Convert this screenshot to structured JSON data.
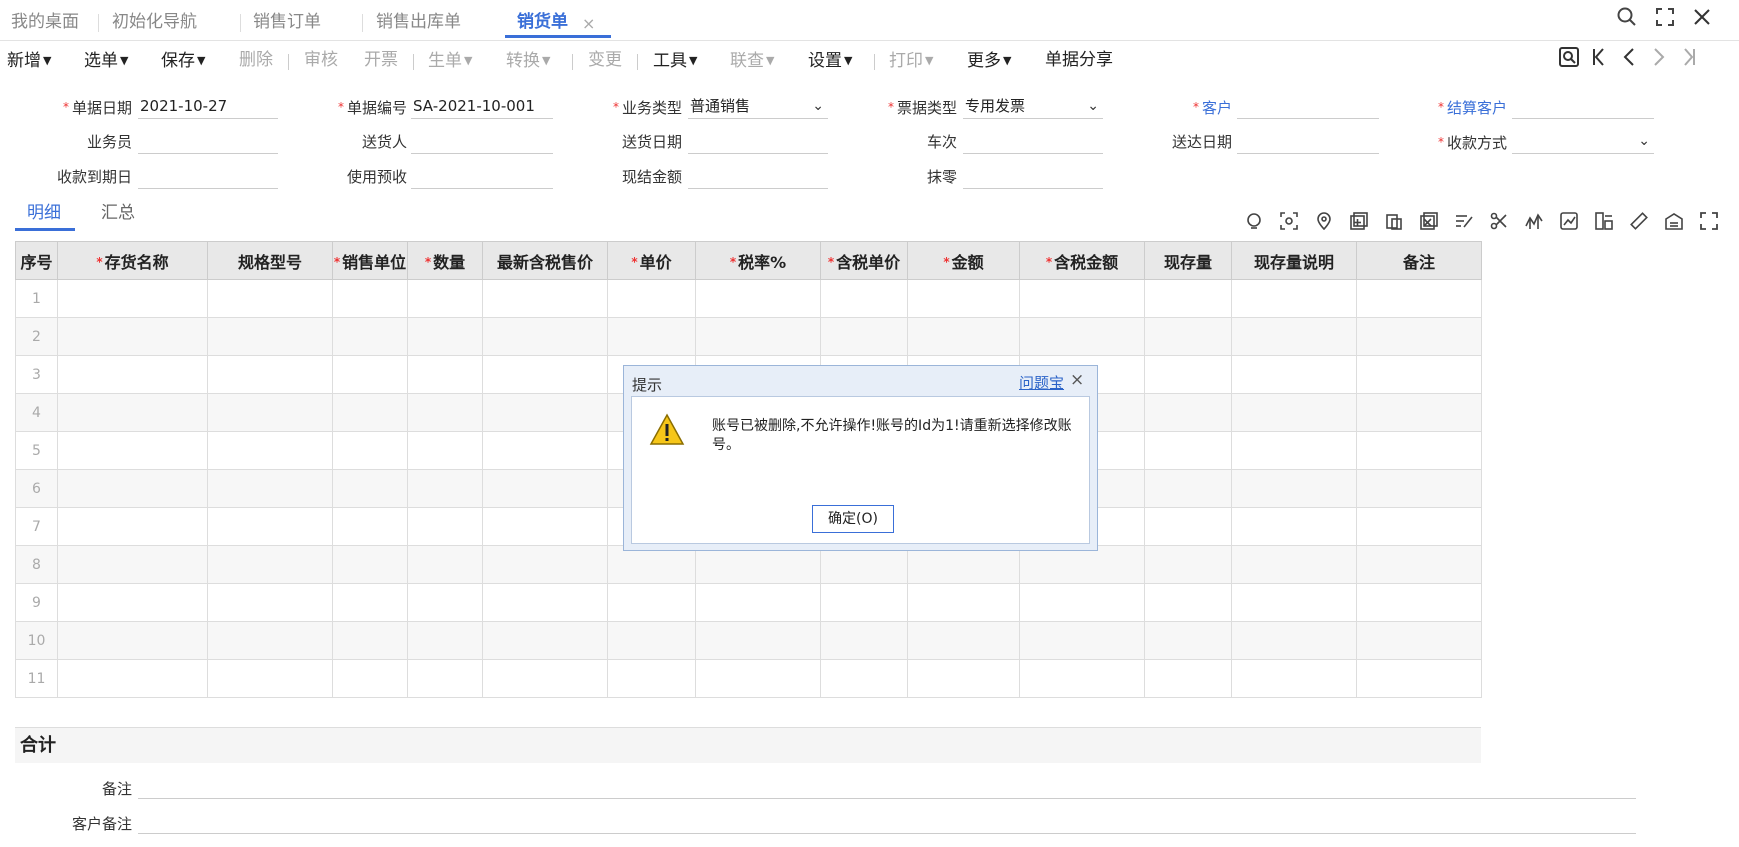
{
  "tabs": [
    {
      "label": "我的桌面"
    },
    {
      "label": "初始化导航"
    },
    {
      "label": "销售订单"
    },
    {
      "label": "销售出库单"
    },
    {
      "label": "销货单",
      "active": true
    }
  ],
  "tab_close": "×",
  "window_icons": [
    "search-icon",
    "fullscreen-icon",
    "close-icon"
  ],
  "toolbar": {
    "new": "新增",
    "select": "选单",
    "save": "保存",
    "delete": "删除",
    "audit": "审核",
    "invoice": "开票",
    "generate": "生单",
    "convert": "转换",
    "change": "变更",
    "tools": "工具",
    "link": "联查",
    "settings": "设置",
    "print": "打印",
    "more": "更多",
    "share": "单据分享"
  },
  "form": {
    "doc_date_label": "单据日期",
    "doc_date": "2021-10-27",
    "doc_no_label": "单据编号",
    "doc_no": "SA-2021-10-001",
    "biz_type_label": "业务类型",
    "biz_type": "普通销售",
    "invoice_type_label": "票据类型",
    "invoice_type": "专用发票",
    "customer_label": "客户",
    "settle_customer_label": "结算客户",
    "salesman_label": "业务员",
    "deliverer_label": "送货人",
    "delivery_date_label": "送货日期",
    "trip_label": "车次",
    "arrival_date_label": "送达日期",
    "payment_method_label": "收款方式",
    "due_date_label": "收款到期日",
    "use_prepay_label": "使用预收",
    "cash_amount_label": "现结金额",
    "round_off_label": "抹零"
  },
  "subtabs": [
    "明细",
    "汇总"
  ],
  "grid": {
    "columns": [
      {
        "label": "序号",
        "req": false
      },
      {
        "label": "存货名称",
        "req": true
      },
      {
        "label": "规格型号",
        "req": false
      },
      {
        "label": "销售单位",
        "req": true
      },
      {
        "label": "数量",
        "req": true
      },
      {
        "label": "最新含税售价",
        "req": false
      },
      {
        "label": "单价",
        "req": true
      },
      {
        "label": "税率%",
        "req": true
      },
      {
        "label": "含税单价",
        "req": true
      },
      {
        "label": "金额",
        "req": true
      },
      {
        "label": "含税金额",
        "req": true
      },
      {
        "label": "现存量",
        "req": false
      },
      {
        "label": "现存量说明",
        "req": false
      },
      {
        "label": "备注",
        "req": false
      }
    ],
    "rows": [
      "1",
      "2",
      "3",
      "4",
      "5",
      "6",
      "7",
      "8",
      "9",
      "10",
      "11"
    ]
  },
  "total_label": "合计",
  "remark_label": "备注",
  "customer_remark_label": "客户备注",
  "dialog": {
    "title": "提示",
    "link": "问题宝",
    "close": "×",
    "message": "账号已被删除,不允许操作!账号的Id为1!请重新选择修改账号。",
    "ok_button": "确定(O)"
  }
}
